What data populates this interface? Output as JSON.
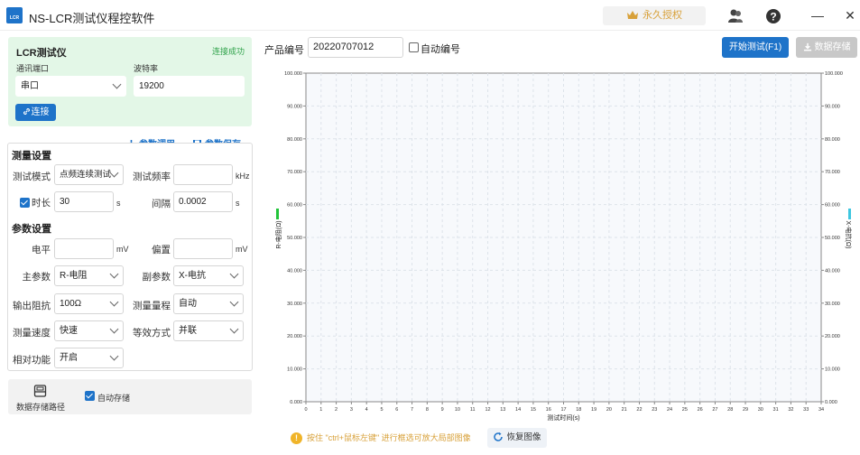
{
  "app": {
    "title": "NS-LCR测试仪程控软件",
    "license_label": "永久授权"
  },
  "window": {
    "minimize": "—",
    "close": "✕"
  },
  "connection": {
    "title": "LCR测试仪",
    "status": "连接成功",
    "port_label": "通讯端口",
    "port_value": "串口",
    "baud_label": "波特率",
    "baud_value": "19200",
    "connect_label": "连接"
  },
  "measure": {
    "load_label": "参数调用",
    "save_label": "参数保存",
    "section_title": "测量设置",
    "mode_label": "测试模式",
    "mode_value": "点频连续测试",
    "freq_label": "测试频率",
    "freq_value": "",
    "freq_unit": "kHz",
    "duration_label": "时长",
    "duration_checked": true,
    "duration_value": "30",
    "duration_unit": "s",
    "interval_label": "间隔",
    "interval_value": "0.0002",
    "interval_unit": "s"
  },
  "params": {
    "section_title": "参数设置",
    "level_label": "电平",
    "level_value": "",
    "level_unit": "mV",
    "bias_label": "偏置",
    "bias_value": "",
    "bias_unit": "mV",
    "primary_label": "主参数",
    "primary_value": "R-电阻",
    "secondary_label": "副参数",
    "secondary_value": "X-电抗",
    "impedance_label": "输出阻抗",
    "impedance_value": "100Ω",
    "range_label": "测量量程",
    "range_value": "自动",
    "speed_label": "测量速度",
    "speed_value": "快速",
    "equiv_label": "等效方式",
    "equiv_value": "并联",
    "relative_label": "相对功能",
    "relative_value": "开启"
  },
  "storage": {
    "path_label": "数据存储路径",
    "auto_label": "自动存储",
    "auto_checked": true
  },
  "product": {
    "label": "产品编号",
    "value": "20220707012",
    "auto_label": "自动编号",
    "auto_checked": false
  },
  "actions": {
    "start_label": "开始测试(F1)",
    "save_data_label": "数据存储"
  },
  "hint": {
    "text": "按住 \"ctrl+鼠标左键\" 进行框选可放大局部图像",
    "restore_label": "恢复图像"
  },
  "colors": {
    "accent": "#1e73c9",
    "success": "#2fa24a",
    "series_left": "#22c43a",
    "series_right": "#3ec7e0",
    "hint": "#d8a13a"
  },
  "chart_data": {
    "type": "line",
    "xlabel": "测试时间(s)",
    "ylabel_left": "R-电阻(Ω)",
    "ylabel_right": "X-电抗(Ω)",
    "xlim": [
      0,
      34
    ],
    "x_ticks": [
      0,
      1,
      2,
      3,
      4,
      5,
      6,
      7,
      8,
      9,
      10,
      11,
      12,
      13,
      14,
      15,
      16,
      17,
      18,
      19,
      20,
      21,
      22,
      23,
      24,
      25,
      26,
      27,
      28,
      29,
      30,
      31,
      32,
      33,
      34
    ],
    "ylim_left": [
      0,
      100
    ],
    "ylim_right": [
      0,
      100
    ],
    "y_ticks_left": [
      "0.000",
      "10.000",
      "20.000",
      "30.000",
      "40.000",
      "50.000",
      "60.000",
      "70.000",
      "80.000",
      "90.000",
      "100.000"
    ],
    "y_ticks_right": [
      "0.000",
      "10.000",
      "20.000",
      "30.000",
      "40.000",
      "50.000",
      "60.000",
      "70.000",
      "80.000",
      "90.000",
      "100.000"
    ],
    "grid": true,
    "series": []
  }
}
